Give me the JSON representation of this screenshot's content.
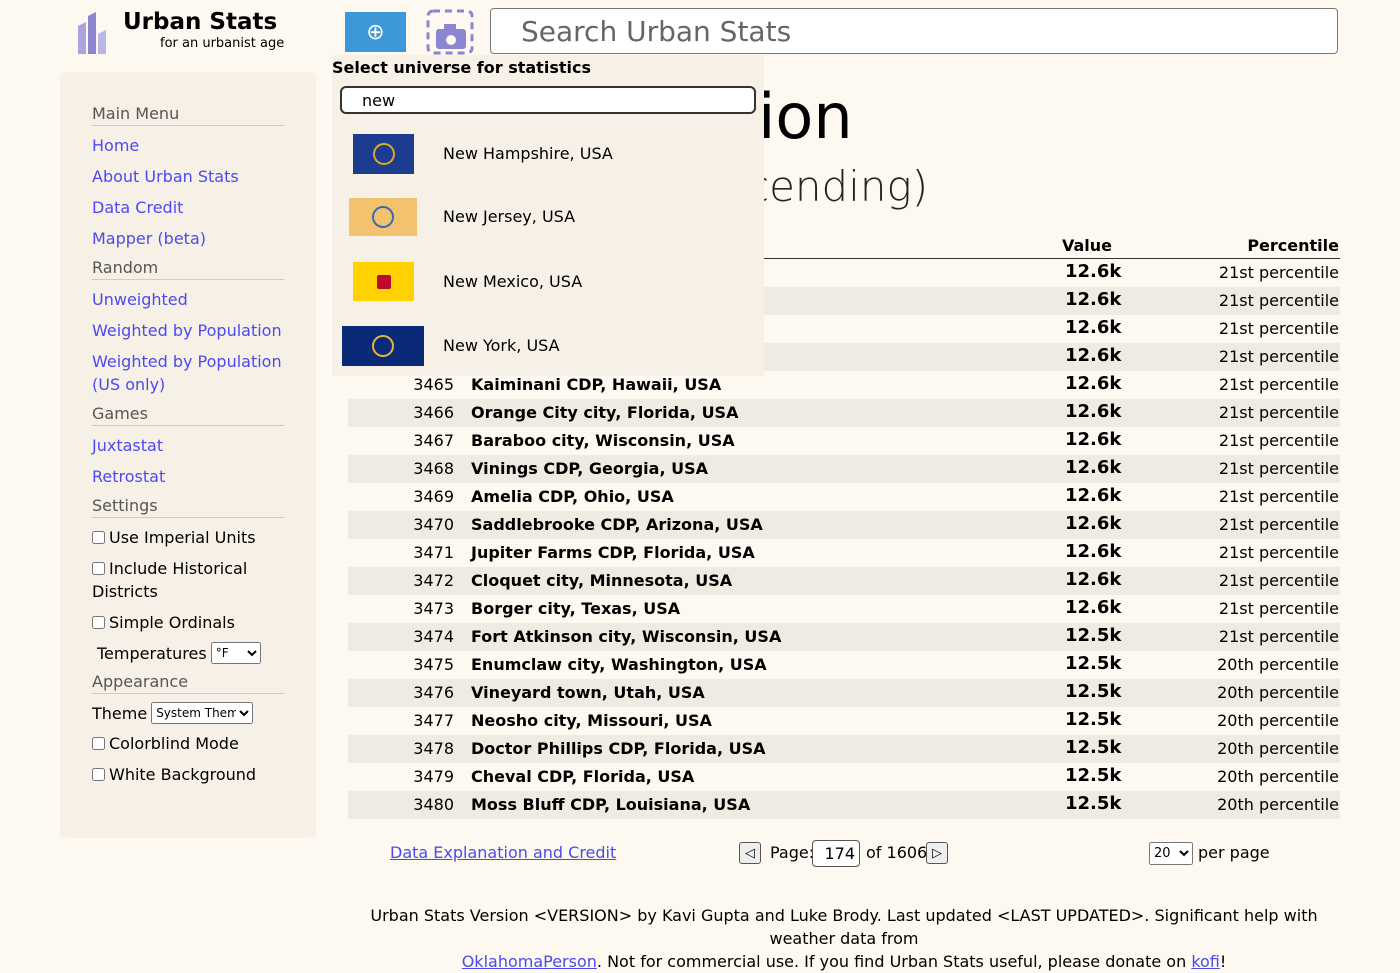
{
  "header": {
    "logo_title": "Urban Stats",
    "logo_subtitle": "for an urbanist age",
    "search_placeholder": "Search Urban Stats",
    "universe_flag_icon": "un-flag-icon",
    "screenshot_icon": "camera-icon"
  },
  "sidebar": {
    "sections": [
      {
        "heading": "Main Menu",
        "links": [
          "Home",
          "About Urban Stats",
          "Data Credit",
          "Mapper (beta)"
        ]
      },
      {
        "heading": "Random",
        "links": [
          "Unweighted",
          "Weighted by Population",
          "Weighted by Population (US only)"
        ]
      },
      {
        "heading": "Games",
        "links": [
          "Juxtastat",
          "Retrostat"
        ]
      }
    ],
    "settings": {
      "heading": "Settings",
      "imperial": "Use Imperial Units",
      "historical": "Include Historical Districts",
      "ordinals": "Simple Ordinals",
      "temperatures_label": "Temperatures",
      "temperatures_value": "°F"
    },
    "appearance": {
      "heading": "Appearance",
      "theme_label": "Theme",
      "theme_value": "System Theme",
      "colorblind": "Colorblind Mode",
      "white_bg": "White Background"
    }
  },
  "page": {
    "title_fragment": "pulation",
    "subtitle_fragment": "s (descending)"
  },
  "table": {
    "headers": {
      "value": "Value",
      "percentile": "Percentile"
    },
    "hidden_rows": [
      {
        "value": "12.6k",
        "percentile": "21st percentile"
      },
      {
        "value": "12.6k",
        "percentile": "21st percentile"
      },
      {
        "value": "12.6k",
        "percentile": "21st percentile"
      },
      {
        "value": "12.6k",
        "percentile": "21st percentile"
      }
    ],
    "rows": [
      {
        "rank": "3465",
        "name": "Kaiminani CDP, Hawaii, USA",
        "value": "12.6k",
        "percentile": "21st percentile"
      },
      {
        "rank": "3466",
        "name": "Orange City city, Florida, USA",
        "value": "12.6k",
        "percentile": "21st percentile"
      },
      {
        "rank": "3467",
        "name": "Baraboo city, Wisconsin, USA",
        "value": "12.6k",
        "percentile": "21st percentile"
      },
      {
        "rank": "3468",
        "name": "Vinings CDP, Georgia, USA",
        "value": "12.6k",
        "percentile": "21st percentile"
      },
      {
        "rank": "3469",
        "name": "Amelia CDP, Ohio, USA",
        "value": "12.6k",
        "percentile": "21st percentile"
      },
      {
        "rank": "3470",
        "name": "Saddlebrooke CDP, Arizona, USA",
        "value": "12.6k",
        "percentile": "21st percentile"
      },
      {
        "rank": "3471",
        "name": "Jupiter Farms CDP, Florida, USA",
        "value": "12.6k",
        "percentile": "21st percentile"
      },
      {
        "rank": "3472",
        "name": "Cloquet city, Minnesota, USA",
        "value": "12.6k",
        "percentile": "21st percentile"
      },
      {
        "rank": "3473",
        "name": "Borger city, Texas, USA",
        "value": "12.6k",
        "percentile": "21st percentile"
      },
      {
        "rank": "3474",
        "name": "Fort Atkinson city, Wisconsin, USA",
        "value": "12.5k",
        "percentile": "21st percentile"
      },
      {
        "rank": "3475",
        "name": "Enumclaw city, Washington, USA",
        "value": "12.5k",
        "percentile": "20th percentile"
      },
      {
        "rank": "3476",
        "name": "Vineyard town, Utah, USA",
        "value": "12.5k",
        "percentile": "20th percentile"
      },
      {
        "rank": "3477",
        "name": "Neosho city, Missouri, USA",
        "value": "12.5k",
        "percentile": "20th percentile"
      },
      {
        "rank": "3478",
        "name": "Doctor Phillips CDP, Florida, USA",
        "value": "12.5k",
        "percentile": "20th percentile"
      },
      {
        "rank": "3479",
        "name": "Cheval CDP, Florida, USA",
        "value": "12.5k",
        "percentile": "20th percentile"
      },
      {
        "rank": "3480",
        "name": "Moss Bluff CDP, Louisiana, USA",
        "value": "12.5k",
        "percentile": "20th percentile"
      }
    ]
  },
  "dropdown": {
    "label": "Select universe for statistics",
    "query": "new",
    "items": [
      {
        "name": "New Hampshire, USA",
        "flag_icon": "new-hampshire-flag-icon",
        "bg": "#1c3d8f",
        "fg": "#d9a62e"
      },
      {
        "name": "New Jersey, USA",
        "flag_icon": "new-jersey-flag-icon",
        "bg": "#f3c26e",
        "fg": "#3a68b0"
      },
      {
        "name": "New Mexico, USA",
        "flag_icon": "new-mexico-flag-icon",
        "bg": "#ffd200",
        "fg": "#bf0a30"
      },
      {
        "name": "New York, USA",
        "flag_icon": "new-york-flag-icon",
        "bg": "#0a2a78",
        "fg": "#e6b33a"
      }
    ]
  },
  "pagination": {
    "credit_link": "Data Explanation and Credit",
    "prev": "◁",
    "next": "▷",
    "page_label": "Page:",
    "page_value": "174",
    "of_text": "of 1606",
    "per_page_value": "20",
    "per_page_label": "per page"
  },
  "footer": {
    "text_1": "Urban Stats Version <VERSION> by Kavi Gupta and Luke Brody. Last updated <LAST UPDATED>. Significant help with weather data from",
    "link_1": "OklahomaPerson",
    "text_2": ". Not for commercial use. If you find Urban Stats useful, please donate on ",
    "link_2": "kofi",
    "text_3": "!"
  },
  "colors": {
    "background": "#fdf8f0",
    "sidebar": "#f7f0e6",
    "link": "#4a4af0",
    "row_shade": "#f0ebe2"
  }
}
